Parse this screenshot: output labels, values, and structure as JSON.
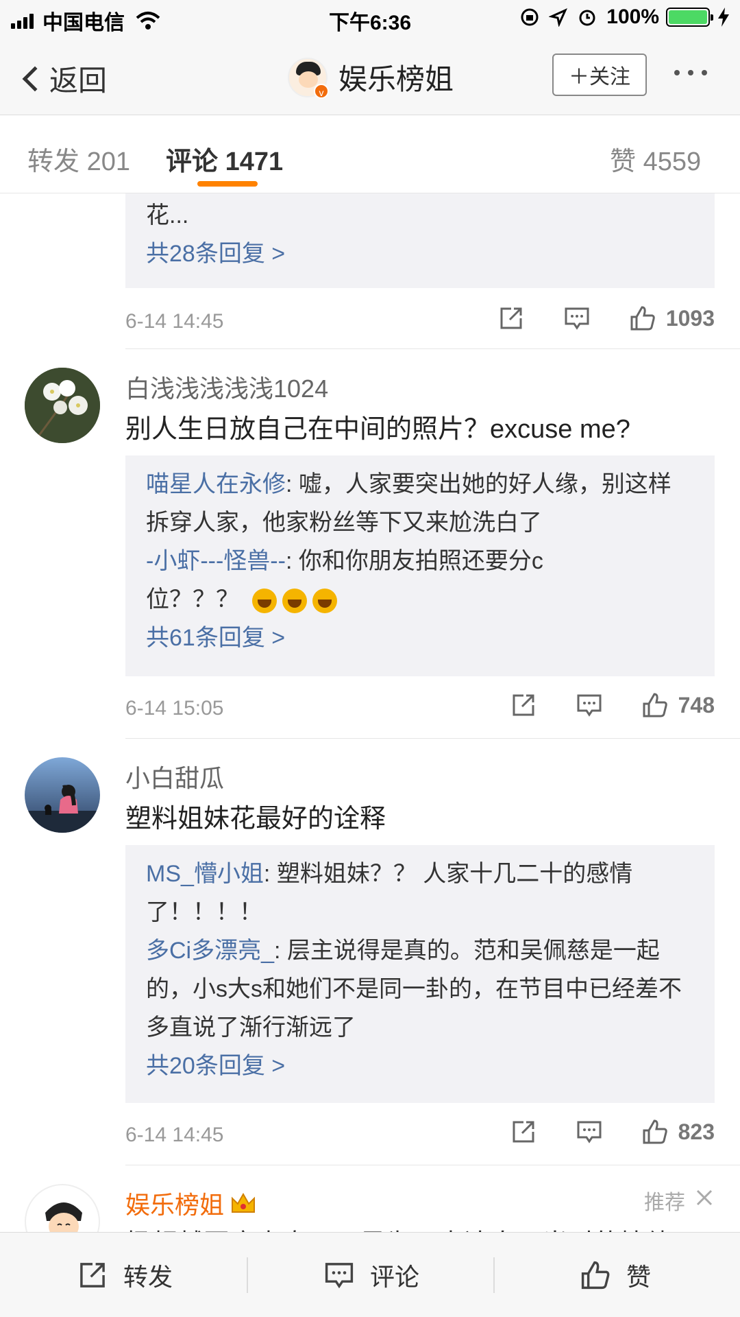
{
  "status_bar": {
    "carrier": "中国电信",
    "time": "下午6:36",
    "battery": "100%",
    "battery_level": 1.0
  },
  "nav": {
    "back_label": "返回",
    "title": "娱乐榜姐",
    "follow_label": "＋关注"
  },
  "tabs": [
    {
      "label": "转发",
      "count": "201"
    },
    {
      "label": "评论",
      "count": "1471"
    },
    {
      "label": "赞",
      "count": "4559"
    }
  ],
  "comments": [
    {
      "replies": [
        {
          "user": "",
          "text": "花..."
        }
      ],
      "more": "共28条回复 >",
      "time": "6-14 14:45",
      "likes": "1093"
    },
    {
      "user": "白浅浅浅浅浅1024",
      "text": "别人生日放自己在中间的照片？excuse me?",
      "replies": [
        {
          "user": "喵星人在永修",
          "text": "嘘，人家要突出她的好人缘，别这样拆穿人家，他家粉丝等下又来尬洗白了"
        },
        {
          "user": "-小虾---怪兽--",
          "text": "你和你朋友拍照还要分c位？？？"
        }
      ],
      "more": "共61条回复 >",
      "time": "6-14 15:05",
      "likes": "748"
    },
    {
      "user": "小白甜瓜",
      "text": "塑料姐妹花最好的诠释",
      "replies": [
        {
          "user": "MS_懵小姐",
          "text": "塑料姐妹？？ 人家十几二十的感情了！！！！"
        },
        {
          "user": "多Ci多漂亮_",
          "text": "层主说得是真的。范和吴佩慈是一起的，小s大s和她们不是同一卦的，在节目中已经差不多直说了渐行渐远了"
        }
      ],
      "more": "共20条回复 >",
      "time": "6-14 14:45",
      "likes": "823"
    },
    {
      "user": "娱乐榜姐",
      "tag": "推荐",
      "text": "杨超越回应表态，只是为了表达自己当时的情绪"
    }
  ],
  "bottom_bar": {
    "share": "转发",
    "comment": "评论",
    "like": "赞"
  },
  "colors": {
    "accent": "#ff8200",
    "link": "#4a6fa5",
    "reply_bg": "#f2f2f5"
  },
  "icons": [
    "signal-icon",
    "wifi-icon",
    "lock-rotation-icon",
    "location-icon",
    "alarm-icon",
    "battery-icon",
    "charging-icon",
    "chevron-left-icon",
    "more-icon",
    "share-icon",
    "comment-icon",
    "like-icon",
    "crown-icon",
    "close-icon",
    "emoji-laugh-icon"
  ]
}
